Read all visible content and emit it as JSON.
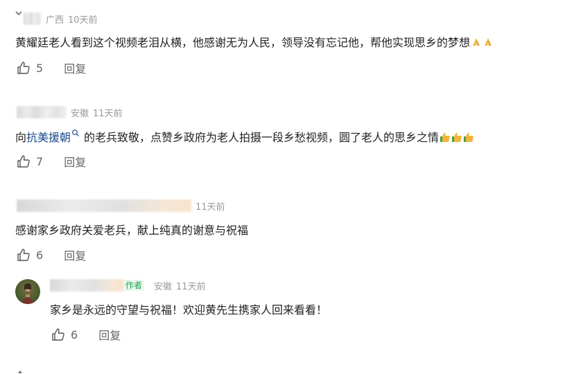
{
  "comments": [
    {
      "location": "广西",
      "time": "10天前",
      "text": "黄耀廷老人看到这个视频老泪从横，他感谢无为人民，领导没有忘记他，帮他实现思乡的梦想",
      "emojis": [
        "praying-hands-emoji",
        "praying-hands-emoji"
      ],
      "likes": "5",
      "reply_label": "回复"
    },
    {
      "location": "安徽",
      "time": "11天前",
      "text_prefix": "向",
      "topic": "抗美援朝",
      "text_suffix": "的老兵致敬，点赞乡政府为老人拍摄一段乡愁视频，圆了老人的思乡之情",
      "emojis": [
        "thumbs-up-emoji",
        "thumbs-up-emoji",
        "thumbs-up-emoji"
      ],
      "likes": "7",
      "reply_label": "回复"
    },
    {
      "time": "11天前",
      "text": "感谢家乡政府关爱老兵，献上纯真的谢意与祝福",
      "likes": "6",
      "reply_label": "回复"
    }
  ],
  "reply": {
    "badge": "作者",
    "location": "安徽",
    "time": "11天前",
    "text": "家乡是永远的守望与祝福！欢迎黄先生携家人回来看看！",
    "likes": "6",
    "reply_label": "回复"
  },
  "colors": {
    "text": "#222222",
    "meta": "#999999",
    "topic_link": "#1a4a8c",
    "author_badge": "#16a34a"
  }
}
